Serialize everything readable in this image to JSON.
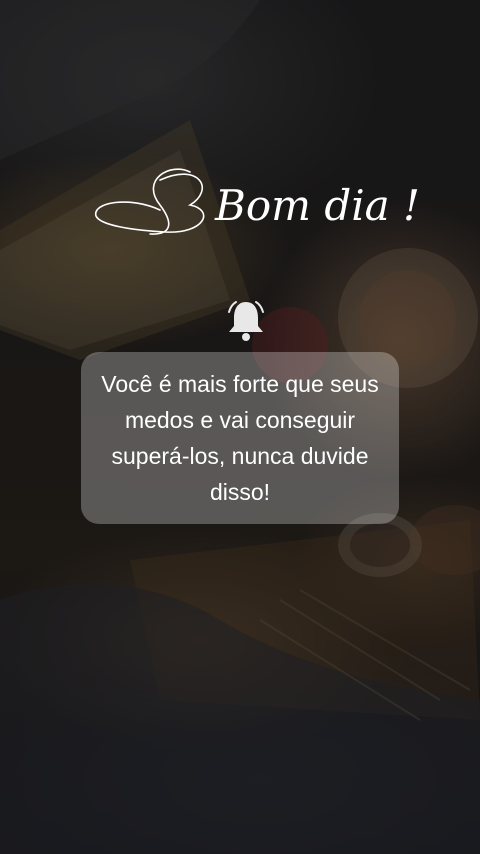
{
  "greeting": {
    "text": "Bom dia !"
  },
  "notification": {
    "icon": "bell-icon"
  },
  "message": {
    "text": "Você é mais forte que seus medos e vai conseguir superá-los, nunca duvide disso!"
  },
  "colors": {
    "text": "#ffffff",
    "card": "rgba(255,255,255,0.28)",
    "bell": "#e8e8e8"
  }
}
